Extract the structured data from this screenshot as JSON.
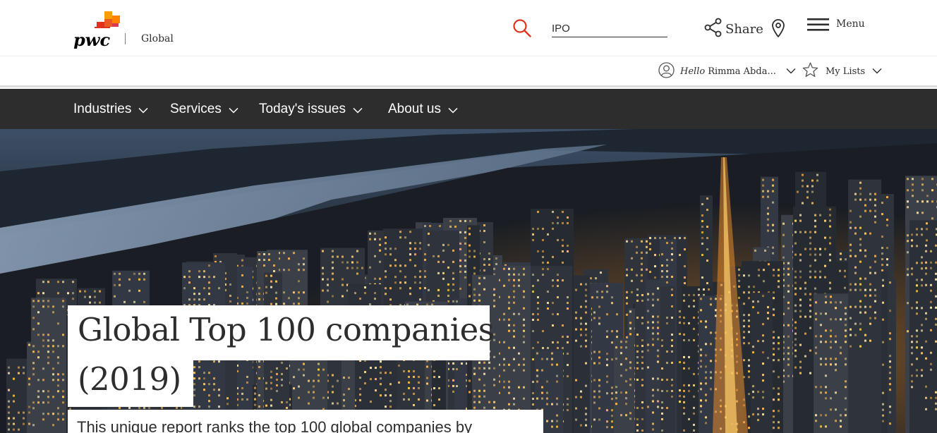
{
  "header": {
    "logo_text": "pwc",
    "territory": "Global",
    "search": {
      "value": "IPO",
      "placeholder": "Search"
    },
    "share_label": "Share",
    "menu_label": "Menu"
  },
  "user_bar": {
    "hello": "Hello",
    "user_name": "Rimma Abda...",
    "my_lists_label": "My Lists"
  },
  "nav": {
    "items": [
      {
        "label": "Industries"
      },
      {
        "label": "Services"
      },
      {
        "label": "Today's issues"
      },
      {
        "label": "About us"
      }
    ]
  },
  "hero": {
    "title_line1": "Global Top 100 companies",
    "title_line2": "(2019)",
    "description": "This unique report ranks the top 100 global companies by"
  },
  "colors": {
    "brand_orange": "#e0301e",
    "brand_red": "#d93954",
    "brand_yellow": "#ffb600",
    "nav_bg": "#2d2d2d",
    "text": "#2d2d2d"
  }
}
